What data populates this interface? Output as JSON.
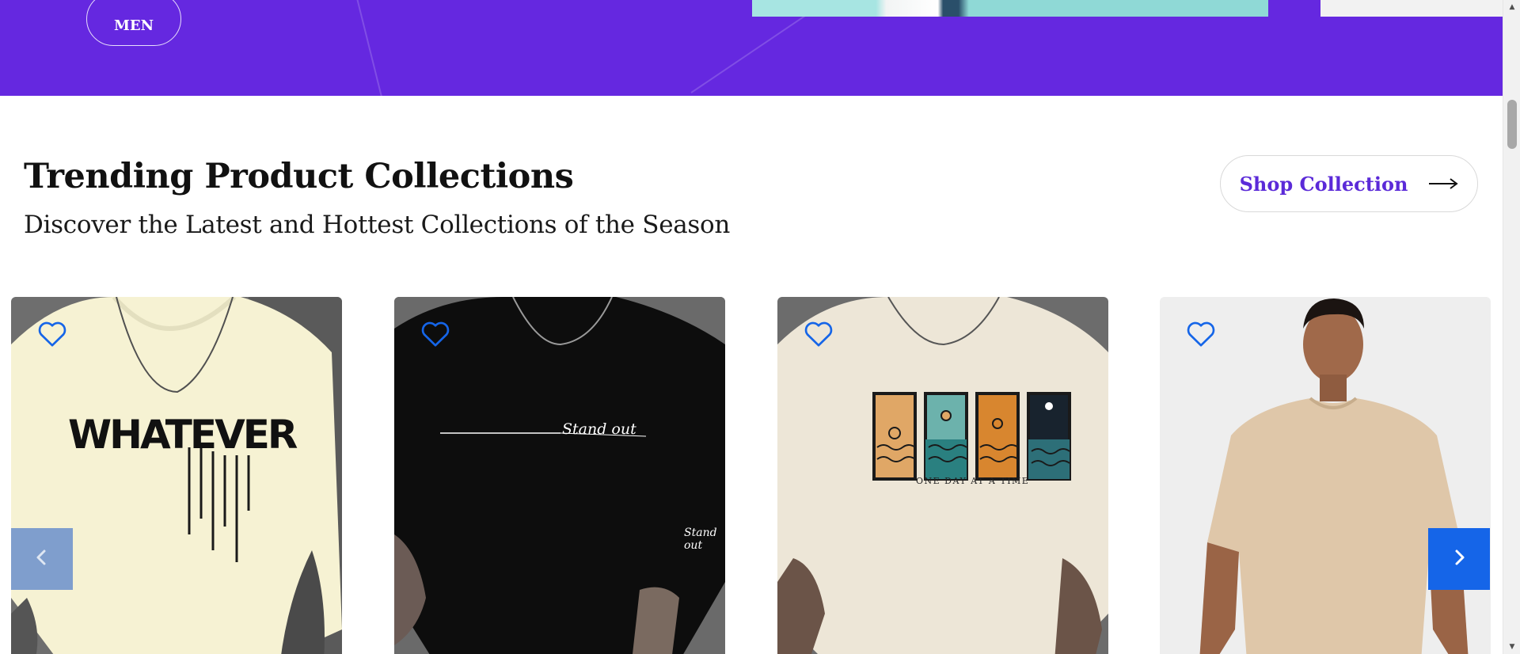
{
  "hero": {
    "men_button_label": "MEN",
    "background_color": "#6528e0"
  },
  "collection_section": {
    "title": "Trending Product Collections",
    "subtitle": "Discover the Latest and Hottest Collections of the Season",
    "shop_button": {
      "label": "Shop Collection",
      "icon": "arrow-right-icon",
      "color": "#5b2ad8"
    }
  },
  "products": [
    {
      "name": "whatever-tee",
      "print_text": "WHATEVER",
      "shirt_color": "#f6f2d3",
      "wishlist_icon": "heart-outline-icon"
    },
    {
      "name": "stand-out-tee",
      "print_text": "Stand out",
      "sleeve_text": "Stand out",
      "shirt_color": "#0d0d0d",
      "wishlist_icon": "heart-outline-icon"
    },
    {
      "name": "one-day-at-a-time-tee",
      "print_text": "ONE DAY AT A TIME",
      "shirt_color": "#ede6d7",
      "wishlist_icon": "heart-outline-icon"
    },
    {
      "name": "beige-basic-tee",
      "shirt_color": "#dfc7a9",
      "wishlist_icon": "heart-outline-icon"
    }
  ],
  "carousel": {
    "prev_icon": "chevron-left-icon",
    "next_icon": "chevron-right-icon",
    "accent_color": "#1565e8"
  },
  "scrollbar": {
    "up_icon": "scroll-up-arrow-icon",
    "down_icon": "scroll-down-arrow-icon"
  }
}
